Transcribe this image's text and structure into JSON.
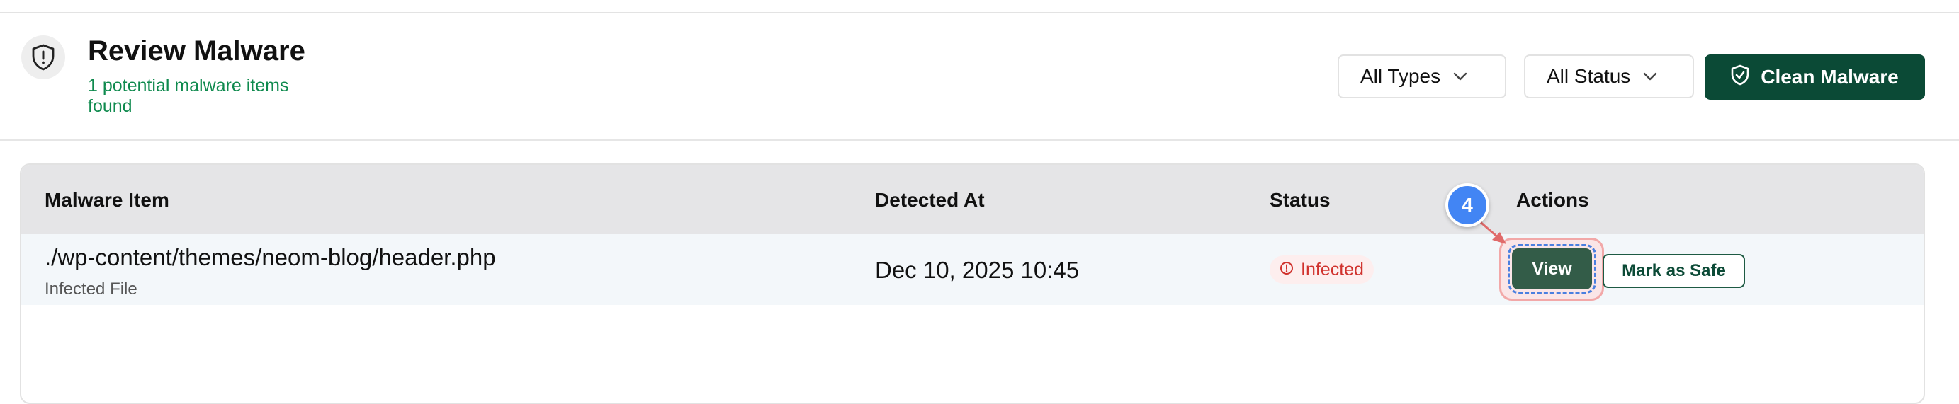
{
  "header": {
    "title": "Review Malware",
    "subtitle": "1 potential malware items found",
    "icon": "shield-alert-icon"
  },
  "filters": {
    "types": {
      "label": "All Types",
      "icon": "chevron-down-icon"
    },
    "status": {
      "label": "All Status",
      "icon": "chevron-down-icon"
    }
  },
  "toolbar": {
    "clean_label": "Clean Malware",
    "clean_icon": "shield-check-icon"
  },
  "table": {
    "columns": [
      "Malware Item",
      "Detected At",
      "Status",
      "Actions"
    ],
    "rows": [
      {
        "path": "./wp-content/themes/neom-blog/header.php",
        "type": "Infected File",
        "detected_at": "Dec 10, 2025 10:45",
        "status": "Infected",
        "actions": {
          "view": "View",
          "mark_safe": "Mark as Safe"
        }
      }
    ]
  },
  "annotation": {
    "step": "4"
  },
  "colors": {
    "brand": "#0b4a36",
    "subtitle": "#0f8a4e",
    "infected": "#d0322d",
    "step_badge": "#4285f4"
  }
}
